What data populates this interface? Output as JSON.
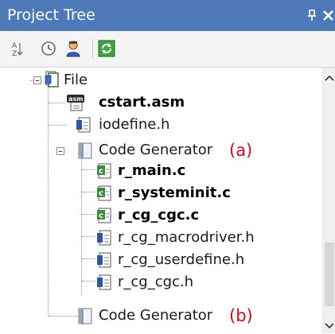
{
  "panel": {
    "title": "Project Tree",
    "pin_glyph": "ᵠ",
    "close_glyph": "×"
  },
  "toolbar": {
    "buttons": [
      {
        "name": "sort-icon"
      },
      {
        "name": "clock-icon"
      },
      {
        "name": "user-icon"
      },
      {
        "name": "refresh-icon"
      }
    ]
  },
  "tree": {
    "items": [
      {
        "label": "File",
        "bold": false,
        "icon": "folder-icon"
      },
      {
        "label": "cstart.asm",
        "bold": true,
        "icon": "asm-file-icon"
      },
      {
        "label": "iodefine.h",
        "bold": false,
        "icon": "header-file-icon"
      },
      {
        "label": "Code Generator",
        "bold": false,
        "icon": "book-icon"
      },
      {
        "label": "r_main.c",
        "bold": true,
        "icon": "c-file-icon"
      },
      {
        "label": "r_systeminit.c",
        "bold": true,
        "icon": "c-file-icon"
      },
      {
        "label": "r_cg_cgc.c",
        "bold": true,
        "icon": "c-file-icon"
      },
      {
        "label": "r_cg_macrodriver.h",
        "bold": false,
        "icon": "header-file-icon"
      },
      {
        "label": "r_cg_userdefine.h",
        "bold": false,
        "icon": "header-file-icon"
      },
      {
        "label": "r_cg_cgc.h",
        "bold": false,
        "icon": "header-file-icon"
      },
      {
        "label": "Code Generator",
        "bold": false,
        "icon": "book-icon"
      }
    ]
  },
  "annotations": {
    "a": "(a)",
    "b": "(b)"
  },
  "colors": {
    "titlebar": "#4d79b8",
    "annotation": "#e2001a"
  }
}
